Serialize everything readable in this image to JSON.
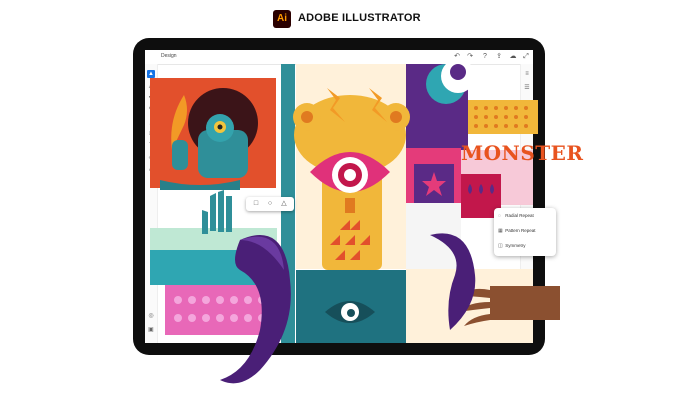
{
  "header": {
    "logo_text": "Ai",
    "title": "ADOBE ILLUSTRATOR"
  },
  "app": {
    "doc_tab": "Design",
    "topbar_icons": [
      "undo-icon",
      "redo-icon",
      "help-icon",
      "share-icon",
      "cloud-icon",
      "expand-icon"
    ],
    "left_tools": [
      "select-icon",
      "direct-select-icon",
      "pen-icon",
      "pencil-icon",
      "brush-icon",
      "shape-icon",
      "type-icon",
      "eraser-icon",
      "eyedropper-icon",
      "fill-icon"
    ],
    "right_tools": [
      "properties-icon",
      "layers-icon"
    ],
    "bottom_tools": [
      "camera-icon",
      "image-icon"
    ],
    "floating_toolbar": [
      "square-icon",
      "circle-icon",
      "triangle-icon"
    ],
    "context_menu": [
      {
        "label": "Radial Repeat",
        "icon": "radial-repeat-icon"
      },
      {
        "label": "Pattern Repeat",
        "icon": "grid-repeat-icon"
      },
      {
        "label": "Symmetry",
        "icon": "symmetry-icon"
      }
    ]
  },
  "artwork": {
    "word": "MONSTER"
  },
  "colors": {
    "brand_bg": "#2b0000",
    "brand_fg": "#ff9a00",
    "accent_orange": "#e8531f",
    "purple": "#5a2a86",
    "teal": "#2f8f99",
    "yellow": "#f1b73a"
  }
}
